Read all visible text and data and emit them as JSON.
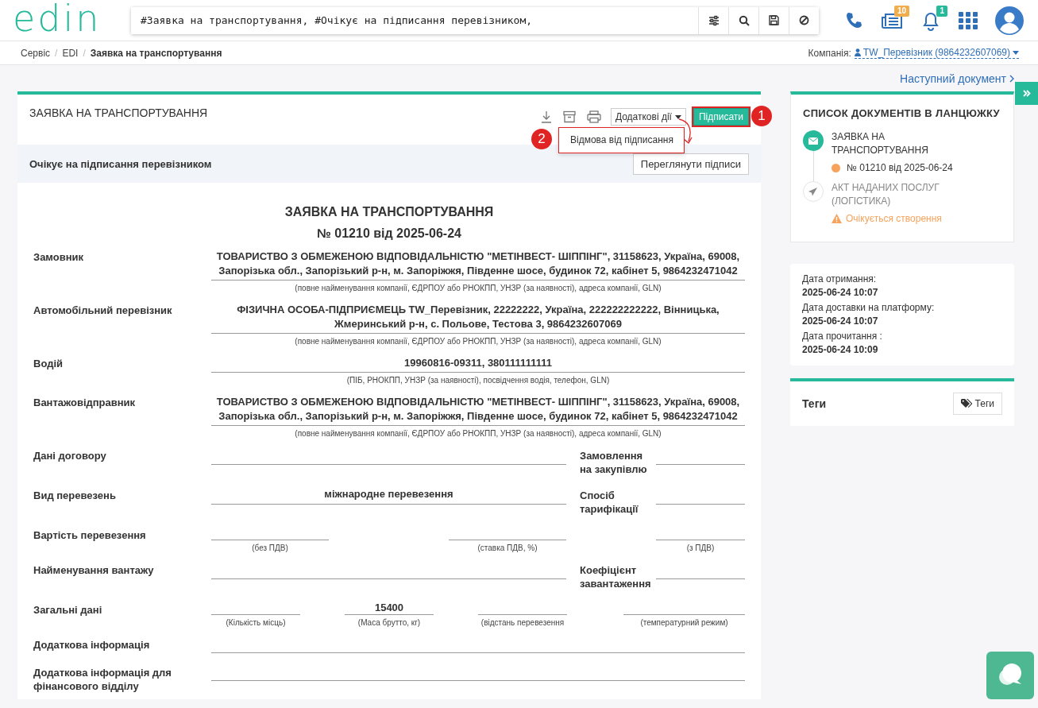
{
  "header": {
    "logo": "edin",
    "search": {
      "value": "#Заявка на транспортування, #Очікує на підписання перевізником,"
    },
    "notifications": [
      {
        "kind": "news",
        "count": "10",
        "color": "#f0ad4e"
      },
      {
        "kind": "bell",
        "count": "1",
        "color": "#26b99a"
      }
    ]
  },
  "breadcrumb": {
    "separator": "/",
    "items": [
      {
        "label": "Сервіс",
        "current": false
      },
      {
        "label": "EDI",
        "current": false
      },
      {
        "label": "Заявка на транспортування",
        "current": true
      }
    ]
  },
  "company": {
    "label": "Компанія:",
    "value": "TW_Перевізник (9864232607069)"
  },
  "next_document": "Наступний документ",
  "document": {
    "title": "ЗАЯВКА НА ТРАНСПОРТУВАННЯ",
    "more_actions": "Додаткові дії",
    "sign_button": "Підписати",
    "menu": {
      "items": [
        "Відмова від підписання"
      ]
    },
    "callouts": [
      "1",
      "2"
    ],
    "status": "Очікує на підписання перевізником",
    "view_signatures": "Переглянути підписи",
    "form": {
      "title": "ЗАЯВКА НА ТРАНСПОРТУВАННЯ",
      "subtitle": "№ 01210 від 2025-06-24",
      "rows": [
        {
          "kind": "party",
          "label": "Замовник",
          "value": "ТОВАРИСТВО З ОБМЕЖЕНОЮ ВІДПОВІДАЛЬНІСТЮ \"МЕТІНВЕСТ- ШІППІНГ\", 31158623, Україна, 69008, Запорізька обл., Запорізький р-н, м. Запоріжжя, Південне шосе, будинок 72, кабінет 5, 9864232471042",
          "hint": "(повне найменування компанії, ЄДРПОУ або РНОКПП, УНЗР (за наявності), адреса компанії, GLN)"
        },
        {
          "kind": "party",
          "label": "Автомобільний перевізник",
          "value": "ФІЗИЧНА ОСОБА-ПІДПРИЄМЕЦЬ TW_Перевізник, 22222222, Україна, 222222222222, Вінницька, Жмеринський р-н, с. Польове, Тестова 3, 9864232607069",
          "hint": "(повне найменування компанії, ЄДРПОУ або РНОКПП, УНЗР (за наявності), адреса компанії, GLN)"
        },
        {
          "kind": "party",
          "label": "Водій",
          "value": "19960816-09311, 380111111111",
          "hint": "(ПІБ, РНОКПП, УНЗР (за наявності), посвідчення водія, телефон, GLN)"
        },
        {
          "kind": "party",
          "label": "Вантажовідправник",
          "value": "ТОВАРИСТВО З ОБМЕЖЕНОЮ ВІДПОВІДАЛЬНІСТЮ \"МЕТІНВЕСТ- ШІППІНГ\", 31158623, Україна, 69008, Запорізька обл., Запорізький р-н, м. Запоріжжя, Південне шосе, будинок 72, кабінет 5, 9864232471042",
          "hint": "(повне найменування компанії, ЄДРПОУ або РНОКПП, УНЗР (за наявності), адреса компанії, GLN)"
        },
        {
          "kind": "split",
          "label": "Дані договору",
          "side_label": "Замовлення на закупівлю"
        },
        {
          "kind": "split",
          "label": "Вид перевезень",
          "value": "міжнародне перевезення",
          "side_label": "Спосіб тарифікації"
        },
        {
          "kind": "fields",
          "label": "Вартість перевезення",
          "fields": [
            {
              "hint": "(без ПДВ)"
            },
            {
              "hint": "(ставка ПДВ, %)"
            },
            {
              "hint": "(з ПДВ)"
            }
          ]
        },
        {
          "kind": "split",
          "label": "Найменування вантажу",
          "side_label": "Коефіцієнт завантаження"
        },
        {
          "kind": "fields",
          "label": "Загальні дані",
          "fields": [
            {
              "hint": "(Кількість місць)"
            },
            {
              "value": "15400",
              "hint": "(Маса брутто, кг)"
            },
            {
              "hint": "(відстань перевезення"
            },
            {
              "hint": "(температурний режим)"
            }
          ]
        },
        {
          "kind": "line",
          "label": "Додаткова інформація"
        },
        {
          "kind": "line",
          "label": "Додаткова інформація для фінансового відділу"
        }
      ]
    }
  },
  "chain": {
    "title": "СПИСОК ДОКУМЕНТІВ В ЛАНЦЮЖКУ",
    "items": [
      {
        "kind": "done",
        "title": "ЗАЯВКА НА ТРАНСПОРТУВАННЯ",
        "number": "№ 01210 від 2025-06-24",
        "color": "#f7a35c"
      },
      {
        "kind": "pending",
        "title": "АКТ НАДАНИХ ПОСЛУГ (ЛОГІСТИКА)",
        "note": "Очікується створення"
      }
    ]
  },
  "dates": [
    {
      "label": "Дата отримання:",
      "value": "2025-06-24 10:07"
    },
    {
      "label": "Дата доставки на платформу:",
      "value": "2025-06-24 10:07"
    },
    {
      "label": "Дата прочитання :",
      "value": "2025-06-24 10:09"
    }
  ],
  "tags": {
    "title": "Теги",
    "button": "Теги"
  }
}
